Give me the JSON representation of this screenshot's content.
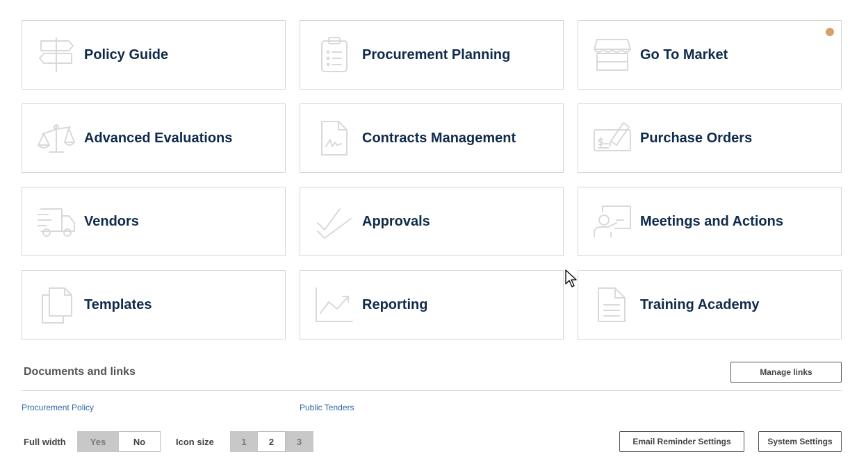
{
  "tiles": [
    {
      "label": "Policy Guide",
      "icon": "signpost-icon"
    },
    {
      "label": "Procurement Planning",
      "icon": "clipboard-list-icon"
    },
    {
      "label": "Go To Market",
      "icon": "storefront-icon",
      "notification": true
    },
    {
      "label": "Advanced Evaluations",
      "icon": "scales-icon"
    },
    {
      "label": "Contracts Management",
      "icon": "signed-document-icon"
    },
    {
      "label": "Purchase Orders",
      "icon": "cheque-icon"
    },
    {
      "label": "Vendors",
      "icon": "delivery-truck-icon"
    },
    {
      "label": "Approvals",
      "icon": "double-check-icon"
    },
    {
      "label": "Meetings and Actions",
      "icon": "presenter-board-icon"
    },
    {
      "label": "Templates",
      "icon": "copy-documents-icon"
    },
    {
      "label": "Reporting",
      "icon": "trend-chart-icon"
    },
    {
      "label": "Training Academy",
      "icon": "document-lines-icon"
    }
  ],
  "documents": {
    "title": "Documents and links",
    "manage_label": "Manage links",
    "links": [
      "Procurement Policy",
      "Public Tenders"
    ]
  },
  "options": {
    "full_width_label": "Full width",
    "full_width_options": [
      "Yes",
      "No"
    ],
    "full_width_selected": "Yes",
    "icon_size_label": "Icon size",
    "icon_size_options": [
      "1",
      "2",
      "3"
    ],
    "icon_size_selected": [
      "1",
      "3"
    ]
  },
  "footer_buttons": {
    "email_reminder": "Email Reminder Settings",
    "system_settings": "System Settings"
  },
  "colors": {
    "tile_label": "#0f2a4a",
    "icon_stroke": "#d9d9d9",
    "notification_dot": "#d4a26b",
    "link": "#2f6aa3",
    "segment_active": "#c8c8c8"
  }
}
